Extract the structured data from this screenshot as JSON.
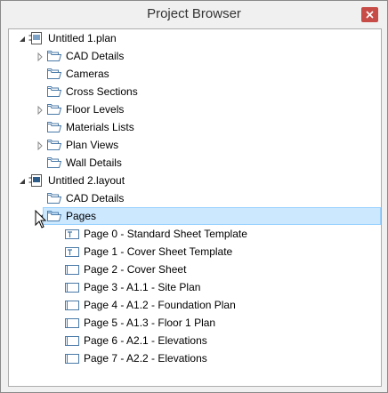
{
  "window": {
    "title": "Project Browser"
  },
  "tree": [
    {
      "label": "Untitled 1.plan",
      "level": 0,
      "expander": "expanded",
      "icon": "plan-file-icon",
      "name": "untitled-1-plan"
    },
    {
      "label": "CAD Details",
      "level": 1,
      "expander": "collapsed",
      "icon": "folder-icon",
      "name": "cad-details-1"
    },
    {
      "label": "Cameras",
      "level": 1,
      "expander": "none",
      "icon": "folder-icon",
      "name": "cameras"
    },
    {
      "label": "Cross Sections",
      "level": 1,
      "expander": "none",
      "icon": "folder-icon",
      "name": "cross-sections"
    },
    {
      "label": "Floor Levels",
      "level": 1,
      "expander": "collapsed",
      "icon": "folder-icon",
      "name": "floor-levels"
    },
    {
      "label": "Materials Lists",
      "level": 1,
      "expander": "none",
      "icon": "folder-icon",
      "name": "materials-lists"
    },
    {
      "label": "Plan Views",
      "level": 1,
      "expander": "collapsed",
      "icon": "folder-icon",
      "name": "plan-views"
    },
    {
      "label": "Wall Details",
      "level": 1,
      "expander": "none",
      "icon": "folder-icon",
      "name": "wall-details"
    },
    {
      "label": "Untitled 2.layout",
      "level": 0,
      "expander": "expanded",
      "icon": "layout-file-icon",
      "name": "untitled-2-layout"
    },
    {
      "label": "CAD Details",
      "level": 1,
      "expander": "none",
      "icon": "folder-icon",
      "name": "cad-details-2"
    },
    {
      "label": "Pages",
      "level": 1,
      "expander": "expanded",
      "icon": "folder-icon",
      "name": "pages",
      "selected": true
    },
    {
      "label": "Page 0 - Standard Sheet Template",
      "level": 2,
      "expander": "none",
      "icon": "template-page-icon",
      "name": "page-0"
    },
    {
      "label": "Page 1 - Cover Sheet Template",
      "level": 2,
      "expander": "none",
      "icon": "template-page-icon",
      "name": "page-1"
    },
    {
      "label": "Page 2 - Cover Sheet",
      "level": 2,
      "expander": "none",
      "icon": "page-icon",
      "name": "page-2"
    },
    {
      "label": "Page 3 - A1.1 - Site Plan",
      "level": 2,
      "expander": "none",
      "icon": "page-icon",
      "name": "page-3"
    },
    {
      "label": "Page 4 - A1.2 - Foundation Plan",
      "level": 2,
      "expander": "none",
      "icon": "page-icon",
      "name": "page-4"
    },
    {
      "label": "Page 5 - A1.3 - Floor 1 Plan",
      "level": 2,
      "expander": "none",
      "icon": "page-icon",
      "name": "page-5"
    },
    {
      "label": "Page 6 - A2.1 - Elevations",
      "level": 2,
      "expander": "none",
      "icon": "page-icon",
      "name": "page-6"
    },
    {
      "label": "Page 7 - A2.2 - Elevations",
      "level": 2,
      "expander": "none",
      "icon": "page-icon",
      "name": "page-7"
    }
  ]
}
